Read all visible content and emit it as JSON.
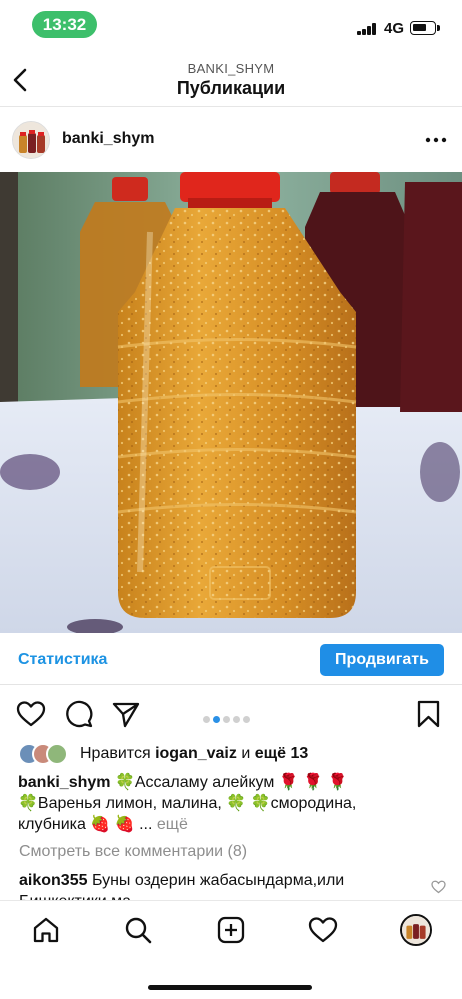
{
  "status_bar": {
    "time": "13:32",
    "network": "4G"
  },
  "header": {
    "account": "BANKI_SHYM",
    "title": "Публикации"
  },
  "post": {
    "username": "banki_shym",
    "insights": {
      "stats_label": "Статистика",
      "promote_label": "Продвигать"
    },
    "carousel": {
      "count": 5,
      "active": 1
    },
    "likes": {
      "prefix": "Нравится",
      "liker": "iogan_vaiz",
      "joiner": "и",
      "others": "ещё 13"
    },
    "caption": {
      "username": "banki_shym",
      "leaf_emoji": "🍀",
      "rose_emoji": "🌹",
      "strawberry_emoji": "🍓",
      "line1": "Ассаламу алейкум",
      "line2a": "Варенья лимон, малина,",
      "line2b": "смородина,",
      "line3": "клубника",
      "ellipsis": "...",
      "more_label": "ещё"
    },
    "view_comments": "Смотреть все комментарии (8)",
    "comment": {
      "username": "aikon355",
      "text": "Буны оздерин жабасындарма,или Бишкектики ма"
    }
  },
  "tabs": [
    "home",
    "search",
    "create",
    "activity",
    "profile"
  ]
}
